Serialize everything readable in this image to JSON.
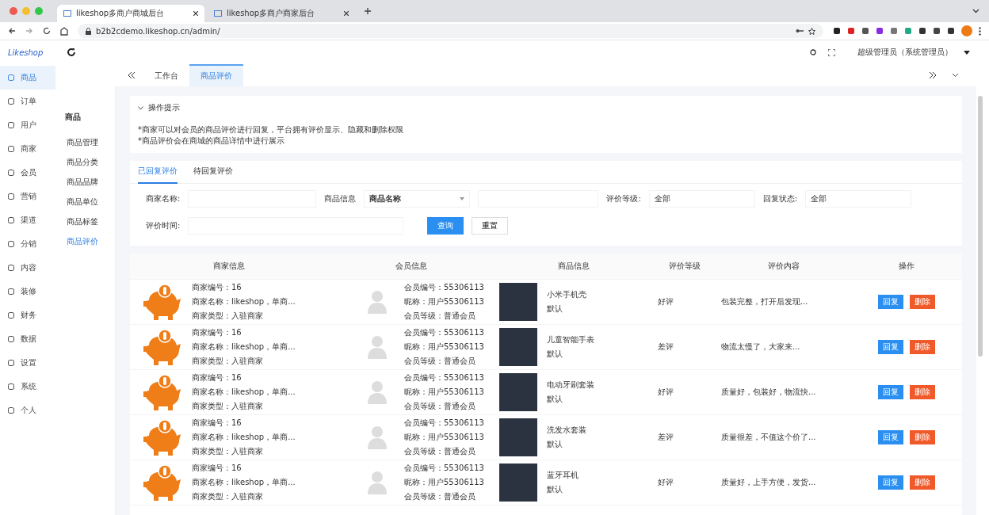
{
  "browser": {
    "tabs": [
      {
        "title": "likeshop多商户商城后台",
        "selected": true
      },
      {
        "title": "likeshop多商户商家后台",
        "selected": false
      }
    ],
    "url": "b2b2cdemo.likeshop.cn/admin/"
  },
  "header": {
    "logo": "Likeshop",
    "user": "超级管理员（系统管理员）"
  },
  "sidebar": {
    "items": [
      {
        "label": "商品",
        "selected": true
      },
      {
        "label": "订单",
        "selected": false
      },
      {
        "label": "用户",
        "selected": false
      },
      {
        "label": "商家",
        "selected": false
      },
      {
        "label": "会员",
        "selected": false
      },
      {
        "label": "营销",
        "selected": false
      },
      {
        "label": "渠道",
        "selected": false
      },
      {
        "label": "分销",
        "selected": false
      },
      {
        "label": "内容",
        "selected": false
      },
      {
        "label": "装修",
        "selected": false
      },
      {
        "label": "财务",
        "selected": false
      },
      {
        "label": "数据",
        "selected": false
      },
      {
        "label": "设置",
        "selected": false
      },
      {
        "label": "系统",
        "selected": false
      },
      {
        "label": "个人",
        "selected": false
      }
    ]
  },
  "submenu": {
    "title": "商品",
    "items": [
      {
        "label": "商品管理",
        "selected": false
      },
      {
        "label": "商品分类",
        "selected": false
      },
      {
        "label": "商品品牌",
        "selected": false
      },
      {
        "label": "商品单位",
        "selected": false
      },
      {
        "label": "商品标签",
        "selected": false
      },
      {
        "label": "商品评价",
        "selected": true
      }
    ]
  },
  "page_tabs": [
    {
      "label": "工作台",
      "selected": false
    },
    {
      "label": "商品评价",
      "selected": true
    }
  ],
  "tips": {
    "title": "操作提示",
    "expanded": true,
    "lines": [
      "*商家可以对会员的商品评价进行回复，平台拥有评价显示、隐藏和删除权限",
      "*商品评价会在商城的商品详情中进行展示"
    ]
  },
  "review_tabs": [
    {
      "label": "已回复评价",
      "selected": true
    },
    {
      "label": "待回复评价",
      "selected": false
    }
  ],
  "filters": {
    "shop_name_label": "商家名称:",
    "goods_label": "商品信息",
    "goods_select": "商品名称",
    "level_label": "评价等级:",
    "level_select": "全部",
    "reply_label": "回复状态:",
    "reply_select": "全部",
    "time_label": "评价时间:",
    "search_button": "查询",
    "reset_button": "重置"
  },
  "table": {
    "columns": [
      "商家信息",
      "会员信息",
      "商品信息",
      "评价等级",
      "评价内容",
      "操作"
    ],
    "rows": [
      {
        "shop_no": "商家编号：16",
        "shop_name": "商家名称：likeshop，单商...",
        "shop_type": "商家类型：入驻商家",
        "member_no": "会员编号：55306113",
        "nickname": "昵称：用户55306113",
        "member_level": "会员等级：普通会员",
        "goods_name": "小米手机壳",
        "spec": "默认",
        "level": "好评",
        "content": "包装完整，打开后发现...",
        "reply": "回复",
        "delete": "删除"
      },
      {
        "shop_no": "商家编号：16",
        "shop_name": "商家名称：likeshop，单商...",
        "shop_type": "商家类型：入驻商家",
        "member_no": "会员编号：55306113",
        "nickname": "昵称：用户55306113",
        "member_level": "会员等级：普通会员",
        "goods_name": "儿童智能手表",
        "spec": "默认",
        "level": "差评",
        "content": "物流太慢了，大家来...",
        "reply": "回复",
        "delete": "删除"
      },
      {
        "shop_no": "商家编号：16",
        "shop_name": "商家名称：likeshop，单商...",
        "shop_type": "商家类型：入驻商家",
        "member_no": "会员编号：55306113",
        "nickname": "昵称：用户55306113",
        "member_level": "会员等级：普通会员",
        "goods_name": "电动牙刷套装",
        "spec": "默认",
        "level": "好评",
        "content": "质量好，包装好，物流快...",
        "reply": "回复",
        "delete": "删除"
      },
      {
        "shop_no": "商家编号：16",
        "shop_name": "商家名称：likeshop，单商...",
        "shop_type": "商家类型：入驻商家",
        "member_no": "会员编号：55306113",
        "nickname": "昵称：用户55306113",
        "member_level": "会员等级：普通会员",
        "goods_name": "洗发水套装",
        "spec": "默认",
        "level": "差评",
        "content": "质量很差，不值这个价了...",
        "reply": "回复",
        "delete": "删除"
      },
      {
        "shop_no": "商家编号：16",
        "shop_name": "商家名称：likeshop，单商...",
        "shop_type": "商家类型：入驻商家",
        "member_no": "会员编号：55306113",
        "nickname": "昵称：用户55306113",
        "member_level": "会员等级：普通会员",
        "goods_name": "蓝牙耳机",
        "spec": "默认",
        "level": "好评",
        "content": "质量好，上手方便，发货...",
        "reply": "回复",
        "delete": "删除"
      }
    ]
  }
}
